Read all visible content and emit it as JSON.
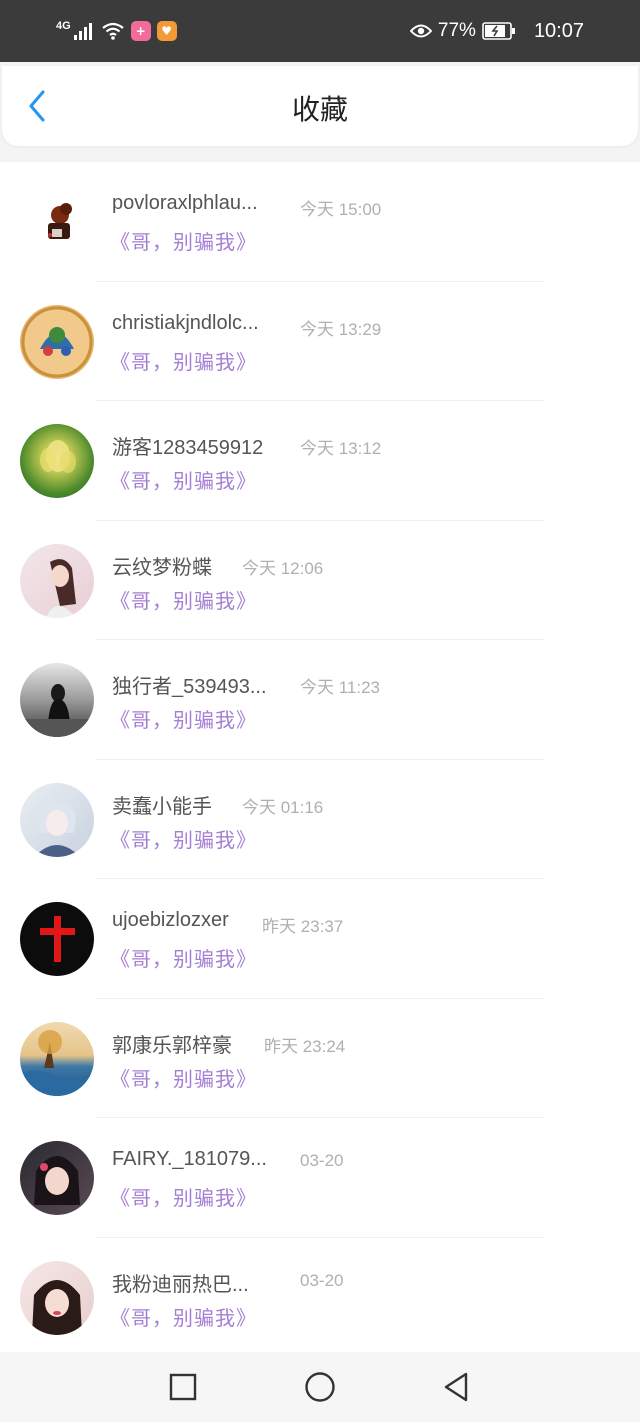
{
  "status_bar": {
    "network": "4G",
    "battery": "77%",
    "time": "10:07",
    "colors": {
      "app1": "#f36b9b",
      "app2": "#f39a36"
    }
  },
  "header": {
    "title": "收藏",
    "back_icon": "chevron-left-icon",
    "accent": "#2196f3"
  },
  "items": [
    {
      "name": "povloraxlphlau...",
      "time": "今天 15:00",
      "quote": "《哥，别骗我》"
    },
    {
      "name": "christiakjndlolc...",
      "time": "今天 13:29",
      "quote": "《哥，别骗我》"
    },
    {
      "name": "游客1283459912",
      "time": "今天 13:12",
      "quote": "《哥，别骗我》"
    },
    {
      "name": "云纹梦粉蝶",
      "time": "今天 12:06",
      "quote": "《哥，别骗我》"
    },
    {
      "name": "独行者_539493...",
      "time": "今天 11:23",
      "quote": "《哥，别骗我》"
    },
    {
      "name": "卖蠢小能手",
      "time": "今天 01:16",
      "quote": "《哥，别骗我》"
    },
    {
      "name": "ujoebizlozxer",
      "time": "昨天 23:37",
      "quote": "《哥，别骗我》"
    },
    {
      "name": "郭康乐郭梓豪",
      "time": "昨天 23:24",
      "quote": "《哥，别骗我》"
    },
    {
      "name": "FAIRY._181079...",
      "time": "03-20",
      "quote": "《哥，别骗我》"
    },
    {
      "name": "我粉迪丽热巴...",
      "time": "03-20",
      "quote": "《哥，别骗我》"
    }
  ],
  "nav": {
    "recent_icon": "square-icon",
    "home_icon": "circle-icon",
    "back_icon": "triangle-back-icon"
  }
}
